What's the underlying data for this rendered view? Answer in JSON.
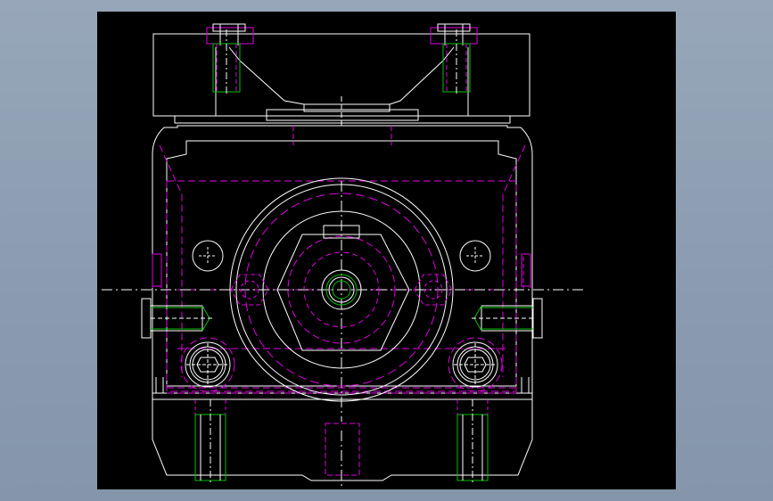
{
  "viewport": {
    "background": "#000000",
    "frame_background": "#91a1b5"
  },
  "palette": {
    "outline": "#ffffff",
    "hidden": "#e000e0",
    "thread": "#00c000"
  },
  "drawing": {
    "views": [
      "front-elevation"
    ],
    "features": [
      "top-clamp-block",
      "main-housing",
      "center-bore",
      "hex-nut",
      "center-shaft",
      "left-socket-head-screw",
      "right-socket-head-screw",
      "left-through-hole",
      "right-through-hole",
      "left-side-threaded-insert",
      "right-side-threaded-insert",
      "bottom-threaded-holes"
    ]
  }
}
